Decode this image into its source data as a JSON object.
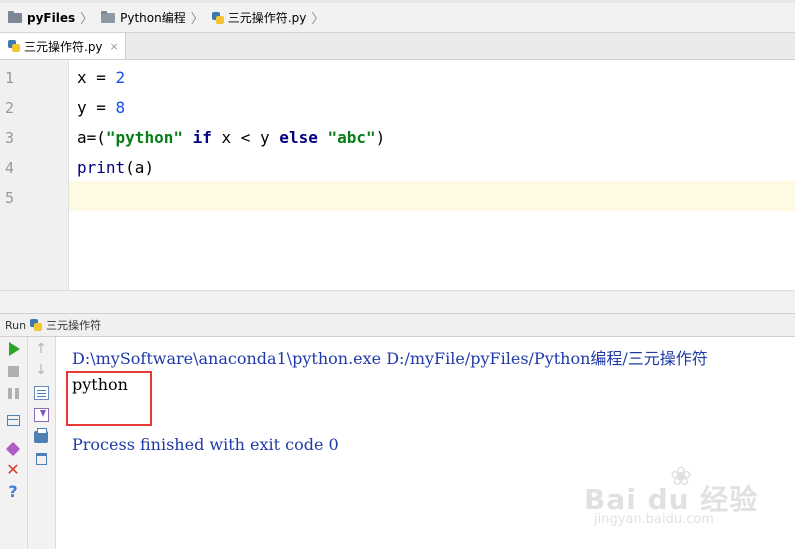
{
  "breadcrumb": {
    "items": [
      "pyFiles",
      "Python编程",
      "三元操作符.py"
    ]
  },
  "tab": {
    "label": "三元操作符.py",
    "close": "×"
  },
  "editor": {
    "line_numbers": [
      "1",
      "2",
      "3",
      "4",
      "5"
    ],
    "lines": [
      {
        "var": "x",
        "op": " = ",
        "num": "2"
      },
      {
        "var": "y",
        "op": " = ",
        "num": "8"
      },
      {
        "a": "a=(",
        "s1": "\"python\"",
        "if": " if ",
        "cmp": "x < y",
        "else": " else ",
        "s2": "\"abc\"",
        "end": ")"
      },
      {
        "fn": "print",
        "args": "(a)"
      }
    ]
  },
  "run": {
    "header_label": "Run",
    "config_name": "三元操作符",
    "command": "D:\\mySoftware\\anaconda1\\python.exe D:/myFile/pyFiles/Python编程/三元操作符",
    "output": "python",
    "exit_message": "Process finished with exit code 0"
  },
  "watermark": {
    "brand": "Bai du 经验",
    "url": "jingyan.baidu.com"
  },
  "colors": {
    "number": "#1750eb",
    "keyword": "#000080",
    "string": "#067d17",
    "console_text": "#1f3aa8",
    "highlight_box": "#e53935"
  }
}
